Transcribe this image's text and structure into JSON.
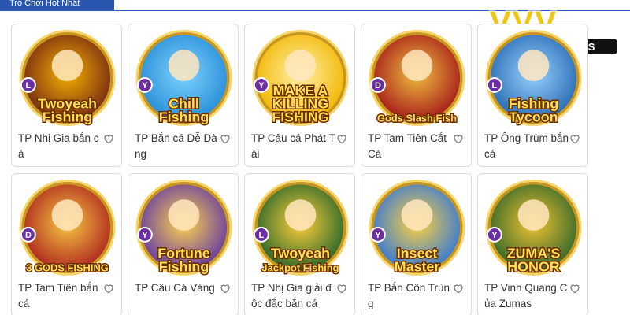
{
  "section": {
    "title": "Trò Chơi Hot Nhất"
  },
  "logo": {
    "mark": "VVV",
    "domain": "VVVWIN.EVENTS"
  },
  "games": [
    {
      "label": "TP Nhị Gia bắn cá",
      "badge": "L",
      "art_text": [
        "Twoyeah",
        "Fishing"
      ],
      "theme": "#7a2d12",
      "glow": "#f5b300"
    },
    {
      "label": "TP Bắn cá Dễ Dàng",
      "badge": "Y",
      "art_text": [
        "Chill",
        "Fishing"
      ],
      "theme": "#2a8fd8",
      "glow": "#7fd3ff"
    },
    {
      "label": "TP Câu cá Phát Tài",
      "badge": "Y",
      "art_text": [
        "MAKE A",
        "KILLING",
        "FISHING"
      ],
      "theme": "#f2b705",
      "glow": "#fff1a8"
    },
    {
      "label": "TP Tam Tiên Cắt Cá",
      "badge": "D",
      "art_text": [
        "Gods Slash Fish"
      ],
      "theme": "#a8201a",
      "glow": "#f0c040"
    },
    {
      "label": "TP Ông Trùm bắn cá",
      "badge": "L",
      "art_text": [
        "Fishing",
        "Tycoon"
      ],
      "theme": "#2c6fb6",
      "glow": "#9ad1ff"
    },
    {
      "label": "TP Tam Tiên bắn cá",
      "badge": "D",
      "art_text": [
        "3 GODS FISHING"
      ],
      "theme": "#b02b1f",
      "glow": "#f7c842"
    },
    {
      "label": "TP Câu Cá Vàng",
      "badge": "Y",
      "art_text": [
        "Fortune",
        "Fishing"
      ],
      "theme": "#6a3fa0",
      "glow": "#ffd34d"
    },
    {
      "label": "TP Nhị Gia giải độc đắc bắn cá",
      "badge": "L",
      "art_text": [
        "Twoyeah",
        "Jackpot Fishing"
      ],
      "theme": "#2f6a2a",
      "glow": "#ffcf3a"
    },
    {
      "label": "TP Bắn Côn Trùng",
      "badge": "Y",
      "art_text": [
        "Insect",
        "Master"
      ],
      "theme": "#3b7bd1",
      "glow": "#ffd23f"
    },
    {
      "label": "TP Vinh Quang Của Zumas",
      "badge": "Y",
      "art_text": [
        "ZUMA'S",
        "HONOR"
      ],
      "theme": "#3a6b2a",
      "glow": "#f2c230"
    }
  ],
  "colors": {
    "accent": "#2a56b0",
    "border": "#dcdcdc",
    "badge": "#6b2fa3",
    "logo_gold": "#f0c814"
  },
  "icons": {
    "favorite": "heart-outline-icon"
  }
}
